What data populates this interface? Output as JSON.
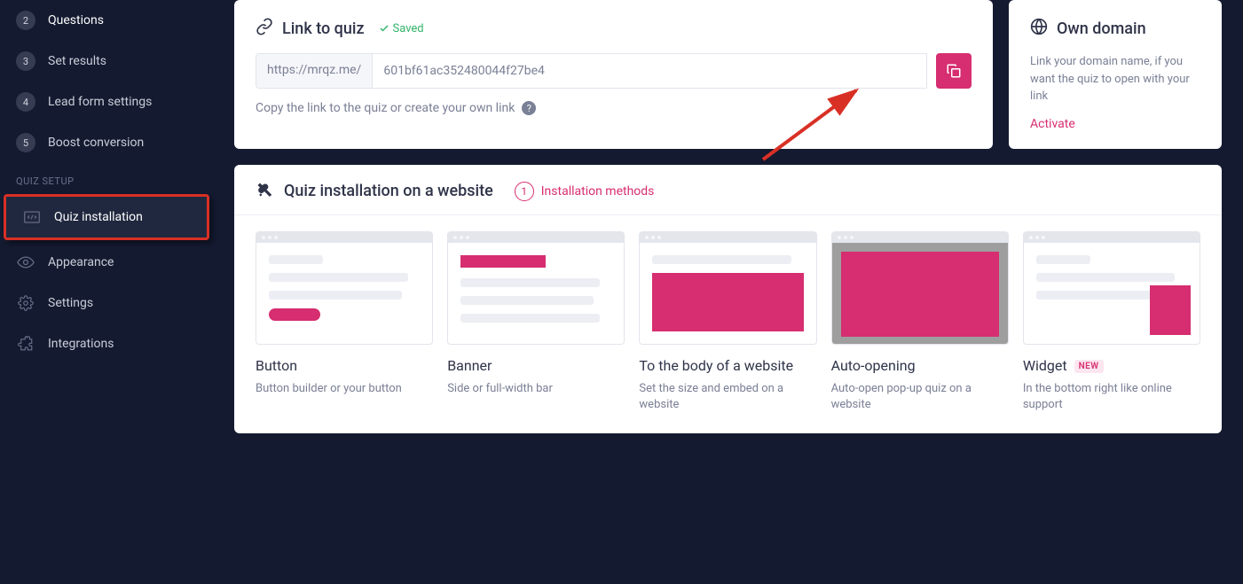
{
  "sidebar": {
    "steps": [
      {
        "num": "2",
        "label": "Questions"
      },
      {
        "num": "3",
        "label": "Set results"
      },
      {
        "num": "4",
        "label": "Lead form settings"
      },
      {
        "num": "5",
        "label": "Boost conversion"
      }
    ],
    "section_label": "QUIZ SETUP",
    "setup_items": {
      "install": "Quiz installation",
      "appearance": "Appearance",
      "settings": "Settings",
      "integrations": "Integrations"
    }
  },
  "link_card": {
    "title": "Link to quiz",
    "saved": "Saved",
    "prefix": "https://mrqz.me/",
    "value": "601bf61ac352480044f27be4",
    "hint": "Copy the link to the quiz or create your own link"
  },
  "domain_card": {
    "title": "Own domain",
    "text": "Link your domain name, if you want the quiz to open with your link",
    "activate": "Activate"
  },
  "install_card": {
    "title": "Quiz installation on a website",
    "methods_num": "1",
    "methods_label": "Installation methods",
    "options": [
      {
        "title": "Button",
        "desc": "Button builder or your button"
      },
      {
        "title": "Banner",
        "desc": "Side or full-width bar"
      },
      {
        "title": "To the body of a website",
        "desc": "Set the size and embed on a website"
      },
      {
        "title": "Auto-opening",
        "desc": "Auto-open pop-up quiz on a website"
      },
      {
        "title": "Widget",
        "desc": "In the bottom right like online support",
        "badge": "NEW"
      }
    ]
  }
}
